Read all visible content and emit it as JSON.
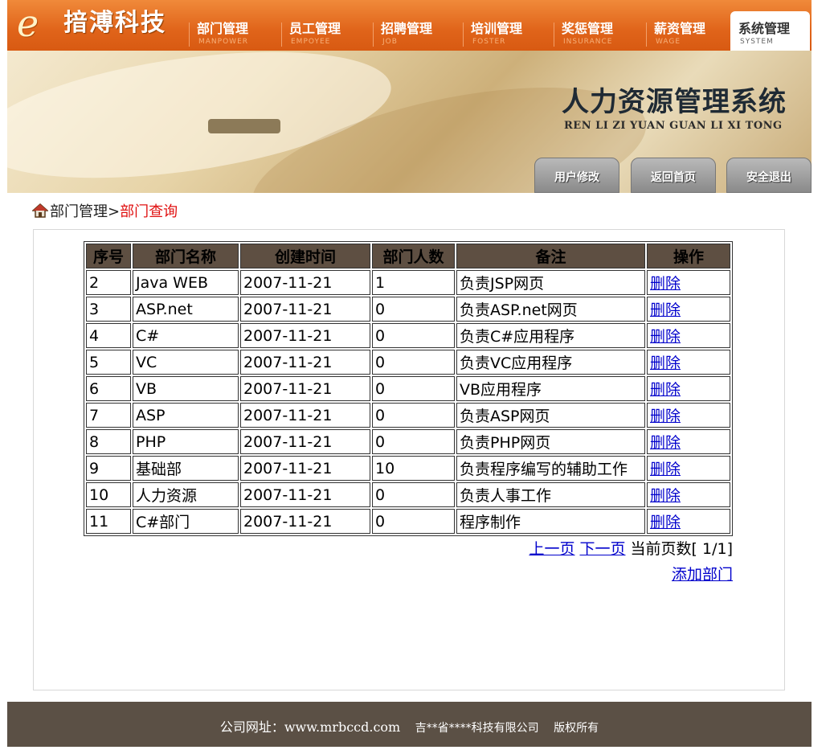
{
  "brand": {
    "logo_letter": "e",
    "name": "揞溥科技"
  },
  "nav": [
    {
      "cn": "部门管理",
      "en": "MANPOWER"
    },
    {
      "cn": "员工管理",
      "en": "EMPOYEE"
    },
    {
      "cn": "招聘管理",
      "en": "JOB"
    },
    {
      "cn": "培训管理",
      "en": "FOSTER"
    },
    {
      "cn": "奖惩管理",
      "en": "INSURANCE"
    },
    {
      "cn": "薪资管理",
      "en": "WAGE"
    },
    {
      "cn": "系统管理",
      "en": "SYSTEM"
    }
  ],
  "active_nav": "系统管理",
  "banner": {
    "title": "人力资源管理系统",
    "pinyin": "REN LI ZI YUAN GUAN LI XI TONG",
    "buttons": [
      "用户修改",
      "返回首页",
      "安全退出"
    ]
  },
  "breadcrumb": {
    "parent": "部门管理",
    "separator": ">",
    "current": "部门查询"
  },
  "table": {
    "headers": [
      "序号",
      "部门名称",
      "创建时间",
      "部门人数",
      "备注",
      "操作"
    ],
    "rows": [
      [
        "2",
        "Java WEB",
        "2007-11-21",
        "1",
        "负责JSP网页",
        "删除"
      ],
      [
        "3",
        "ASP.net",
        "2007-11-21",
        "0",
        "负责ASP.net网页",
        "删除"
      ],
      [
        "4",
        "C#",
        "2007-11-21",
        "0",
        "负责C#应用程序",
        "删除"
      ],
      [
        "5",
        "VC",
        "2007-11-21",
        "0",
        "负责VC应用程序",
        "删除"
      ],
      [
        "6",
        "VB",
        "2007-11-21",
        "0",
        "VB应用程序",
        "删除"
      ],
      [
        "7",
        "ASP",
        "2007-11-21",
        "0",
        "负责ASP网页",
        "删除"
      ],
      [
        "8",
        "PHP",
        "2007-11-21",
        "0",
        "负责PHP网页",
        "删除"
      ],
      [
        "9",
        "基础部",
        "2007-11-21",
        "10",
        "负责程序编写的辅助工作",
        "删除"
      ],
      [
        "10",
        "人力资源",
        "2007-11-21",
        "0",
        "负责人事工作",
        "删除"
      ],
      [
        "11",
        "C#部门",
        "2007-11-21",
        "0",
        "程序制作",
        "删除"
      ]
    ]
  },
  "pager": {
    "prev": "上一页",
    "next": "下一页",
    "status": "当前页数[ 1/1]"
  },
  "add_link": "添加部门",
  "footer": {
    "url": "公司网址：www.mrbccd.com",
    "company": "吉**省****科技有限公司",
    "rights": "版权所有"
  },
  "colors": {
    "header_orange": "#e0641a",
    "table_header": "#5e4f42",
    "footer": "#5b5045",
    "link": "#0000cc",
    "breadcrumb_current": "#e01010"
  }
}
